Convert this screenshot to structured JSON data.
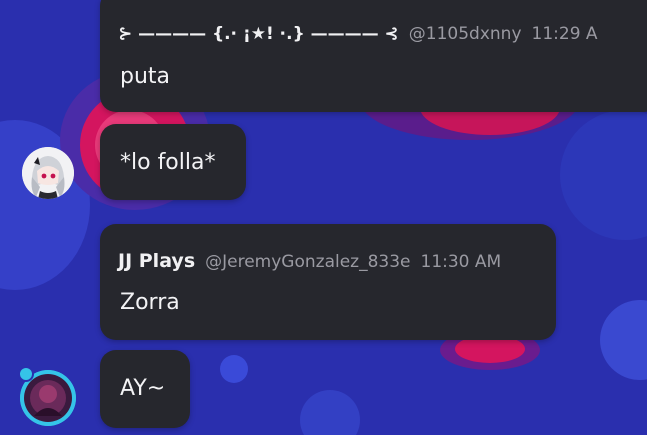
{
  "messages": [
    {
      "name": "⊱ ———— {.⋅ ¡★! ⋅.} ———— ⊰",
      "handle": "@1105dxnny",
      "time": "11:29 A",
      "text": "puta"
    },
    {
      "text": "*lo folla*"
    },
    {
      "name": "JJ Plays",
      "handle": "@JeremyGonzalez_833e",
      "time": "11:30 AM",
      "text": "Zorra"
    },
    {
      "text": "AY~"
    }
  ],
  "colors": {
    "background": "#2a2fae",
    "bubble": "#26272d",
    "accent_pink": "#e0186a",
    "ring_cyan": "#35c4e8"
  }
}
